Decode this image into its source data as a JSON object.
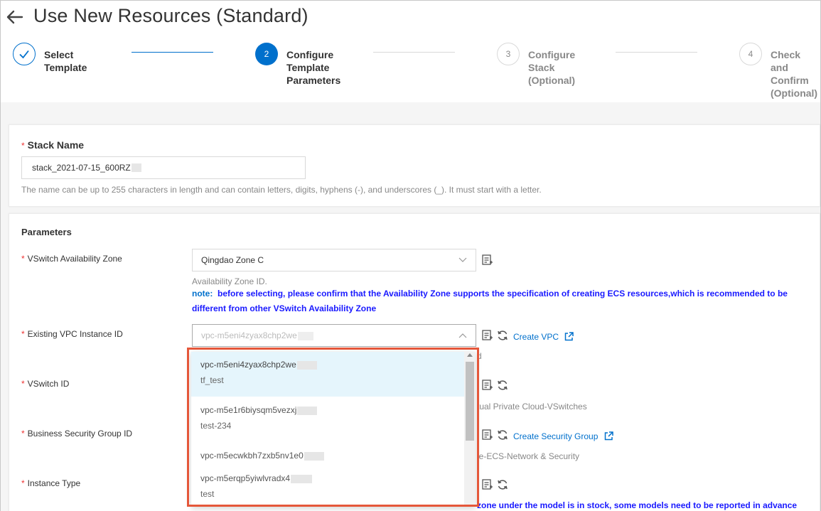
{
  "header": {
    "title": "Use New Resources (Standard)"
  },
  "steps": [
    {
      "number": "1",
      "label": "Select Template",
      "state": "done"
    },
    {
      "number": "2",
      "label": "Configure Template Parameters",
      "state": "active"
    },
    {
      "number": "3",
      "label": "Configure Stack (Optional)",
      "state": "todo"
    },
    {
      "number": "4",
      "label": "Check and Confirm (Optional)",
      "state": "todo"
    }
  ],
  "stack": {
    "required_mark": "*",
    "label": "Stack Name",
    "value": "stack_2021-07-15_600RZ",
    "help": "The name can be up to 255 characters in length and can contain letters, digits, hyphens (-), and underscores (_). It must start with a letter."
  },
  "parameters": {
    "title": "Parameters",
    "vswitch_zone": {
      "label": "VSwitch Availability Zone",
      "value": "Qingdao Zone C",
      "help": "Availability Zone ID.",
      "note_label": "note:",
      "note_text": "before selecting, please confirm that the Availability Zone supports the specification of creating ECS resources,which is recommended to be different from other VSwitch Availability Zone"
    },
    "vpc": {
      "label": "Existing VPC Instance ID",
      "placeholder": "vpc-m5eni4zyax8chp2we",
      "create_link": "Create VPC",
      "help_partial": "d"
    },
    "vswitch_id": {
      "label": "VSwitch ID",
      "help_partial": "tual Private Cloud-VSwitches"
    },
    "security_group": {
      "label": "Business Security Group ID",
      "create_link": "Create Security Group",
      "help_partial": "le-ECS-Network & Security"
    },
    "instance_type": {
      "label": "Instance Type",
      "note_partial": "zone under the model is in stock, some models need to be reported in advance"
    }
  },
  "dropdown": {
    "items": [
      {
        "id": "vpc-m5eni4zyax8chp2we",
        "name": "tf_test",
        "selected": true
      },
      {
        "id": "vpc-m5e1r6biysqm5vezxj",
        "name": "test-234",
        "selected": false
      },
      {
        "id": "vpc-m5ecwkbh7zxb5nv1e0",
        "name": "",
        "selected": false
      },
      {
        "id": "vpc-m5erqp5yiwlvradx4",
        "name": "test",
        "selected": false
      }
    ]
  },
  "colors": {
    "primary": "#0070cc",
    "note_blue": "#1a1aff",
    "highlight": "#e5573a",
    "required": "#ee3333"
  }
}
